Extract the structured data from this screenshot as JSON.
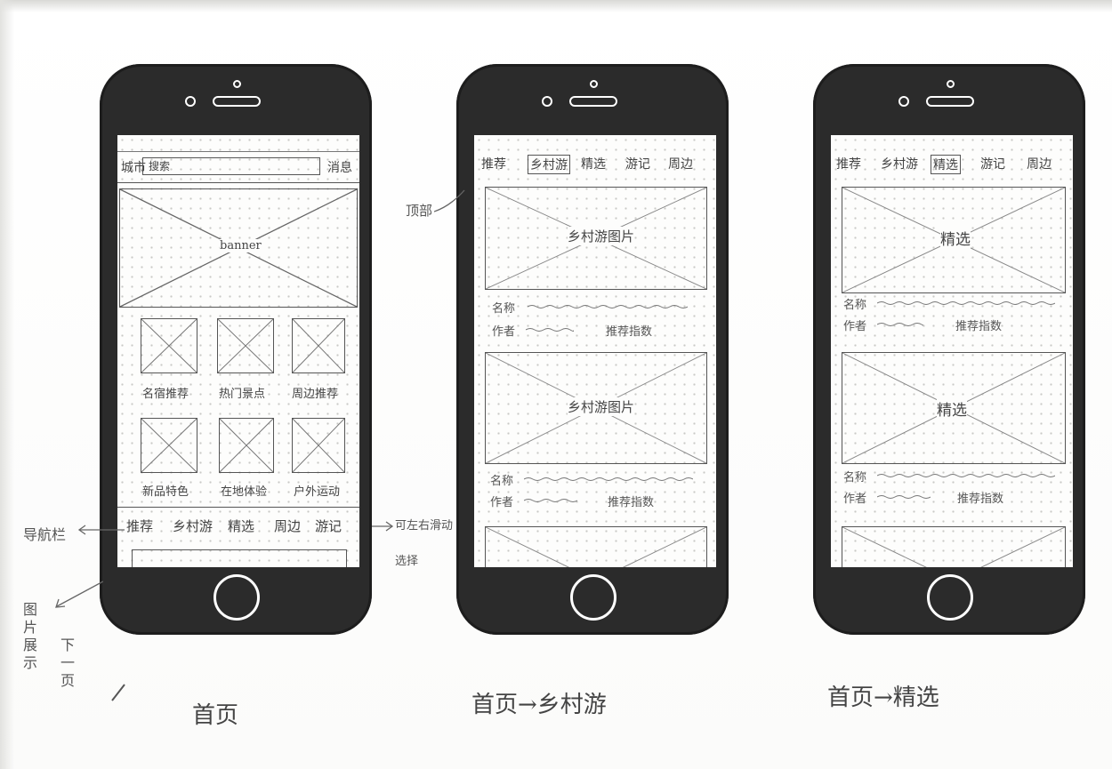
{
  "phone1": {
    "search_left": "城市",
    "search_text": "搜索",
    "search_right": "消息",
    "banner_label": "banner",
    "grid_labels": [
      "名宿推荐",
      "热门景点",
      "周边推荐",
      "新品特色",
      "在地体验",
      "户外运动"
    ],
    "tabs": [
      "推荐",
      "乡村游",
      "精选",
      "周边",
      "游记"
    ],
    "caption": "首页"
  },
  "phone2": {
    "tabs": [
      "推荐",
      "乡村游",
      "精选",
      "游记",
      "周边"
    ],
    "selected_tab": 1,
    "cards": [
      {
        "image_label": "乡村游图片",
        "title_label": "名称",
        "author_label": "作者",
        "action_label": "推荐指数"
      },
      {
        "image_label": "乡村游图片",
        "title_label": "名称",
        "author_label": "作者",
        "action_label": "推荐指数"
      }
    ],
    "caption": "首页→乡村游"
  },
  "phone3": {
    "tabs": [
      "推荐",
      "乡村游",
      "精选",
      "游记",
      "周边"
    ],
    "selected_tab": 2,
    "cards": [
      {
        "image_label": "精选",
        "title_label": "名称",
        "author_label": "作者",
        "action_label": "推荐指数"
      },
      {
        "image_label": "精选",
        "title_label": "名称",
        "author_label": "作者",
        "action_label": "推荐指数"
      }
    ],
    "caption": "首页→精选"
  },
  "annotations": {
    "left_nav": "导航栏",
    "right_nav_1": "可左右滑动",
    "right_nav_2": "选择",
    "phone2_side": "顶部",
    "left_vertical": "图片展示",
    "left_vertical_2": "下一页"
  }
}
